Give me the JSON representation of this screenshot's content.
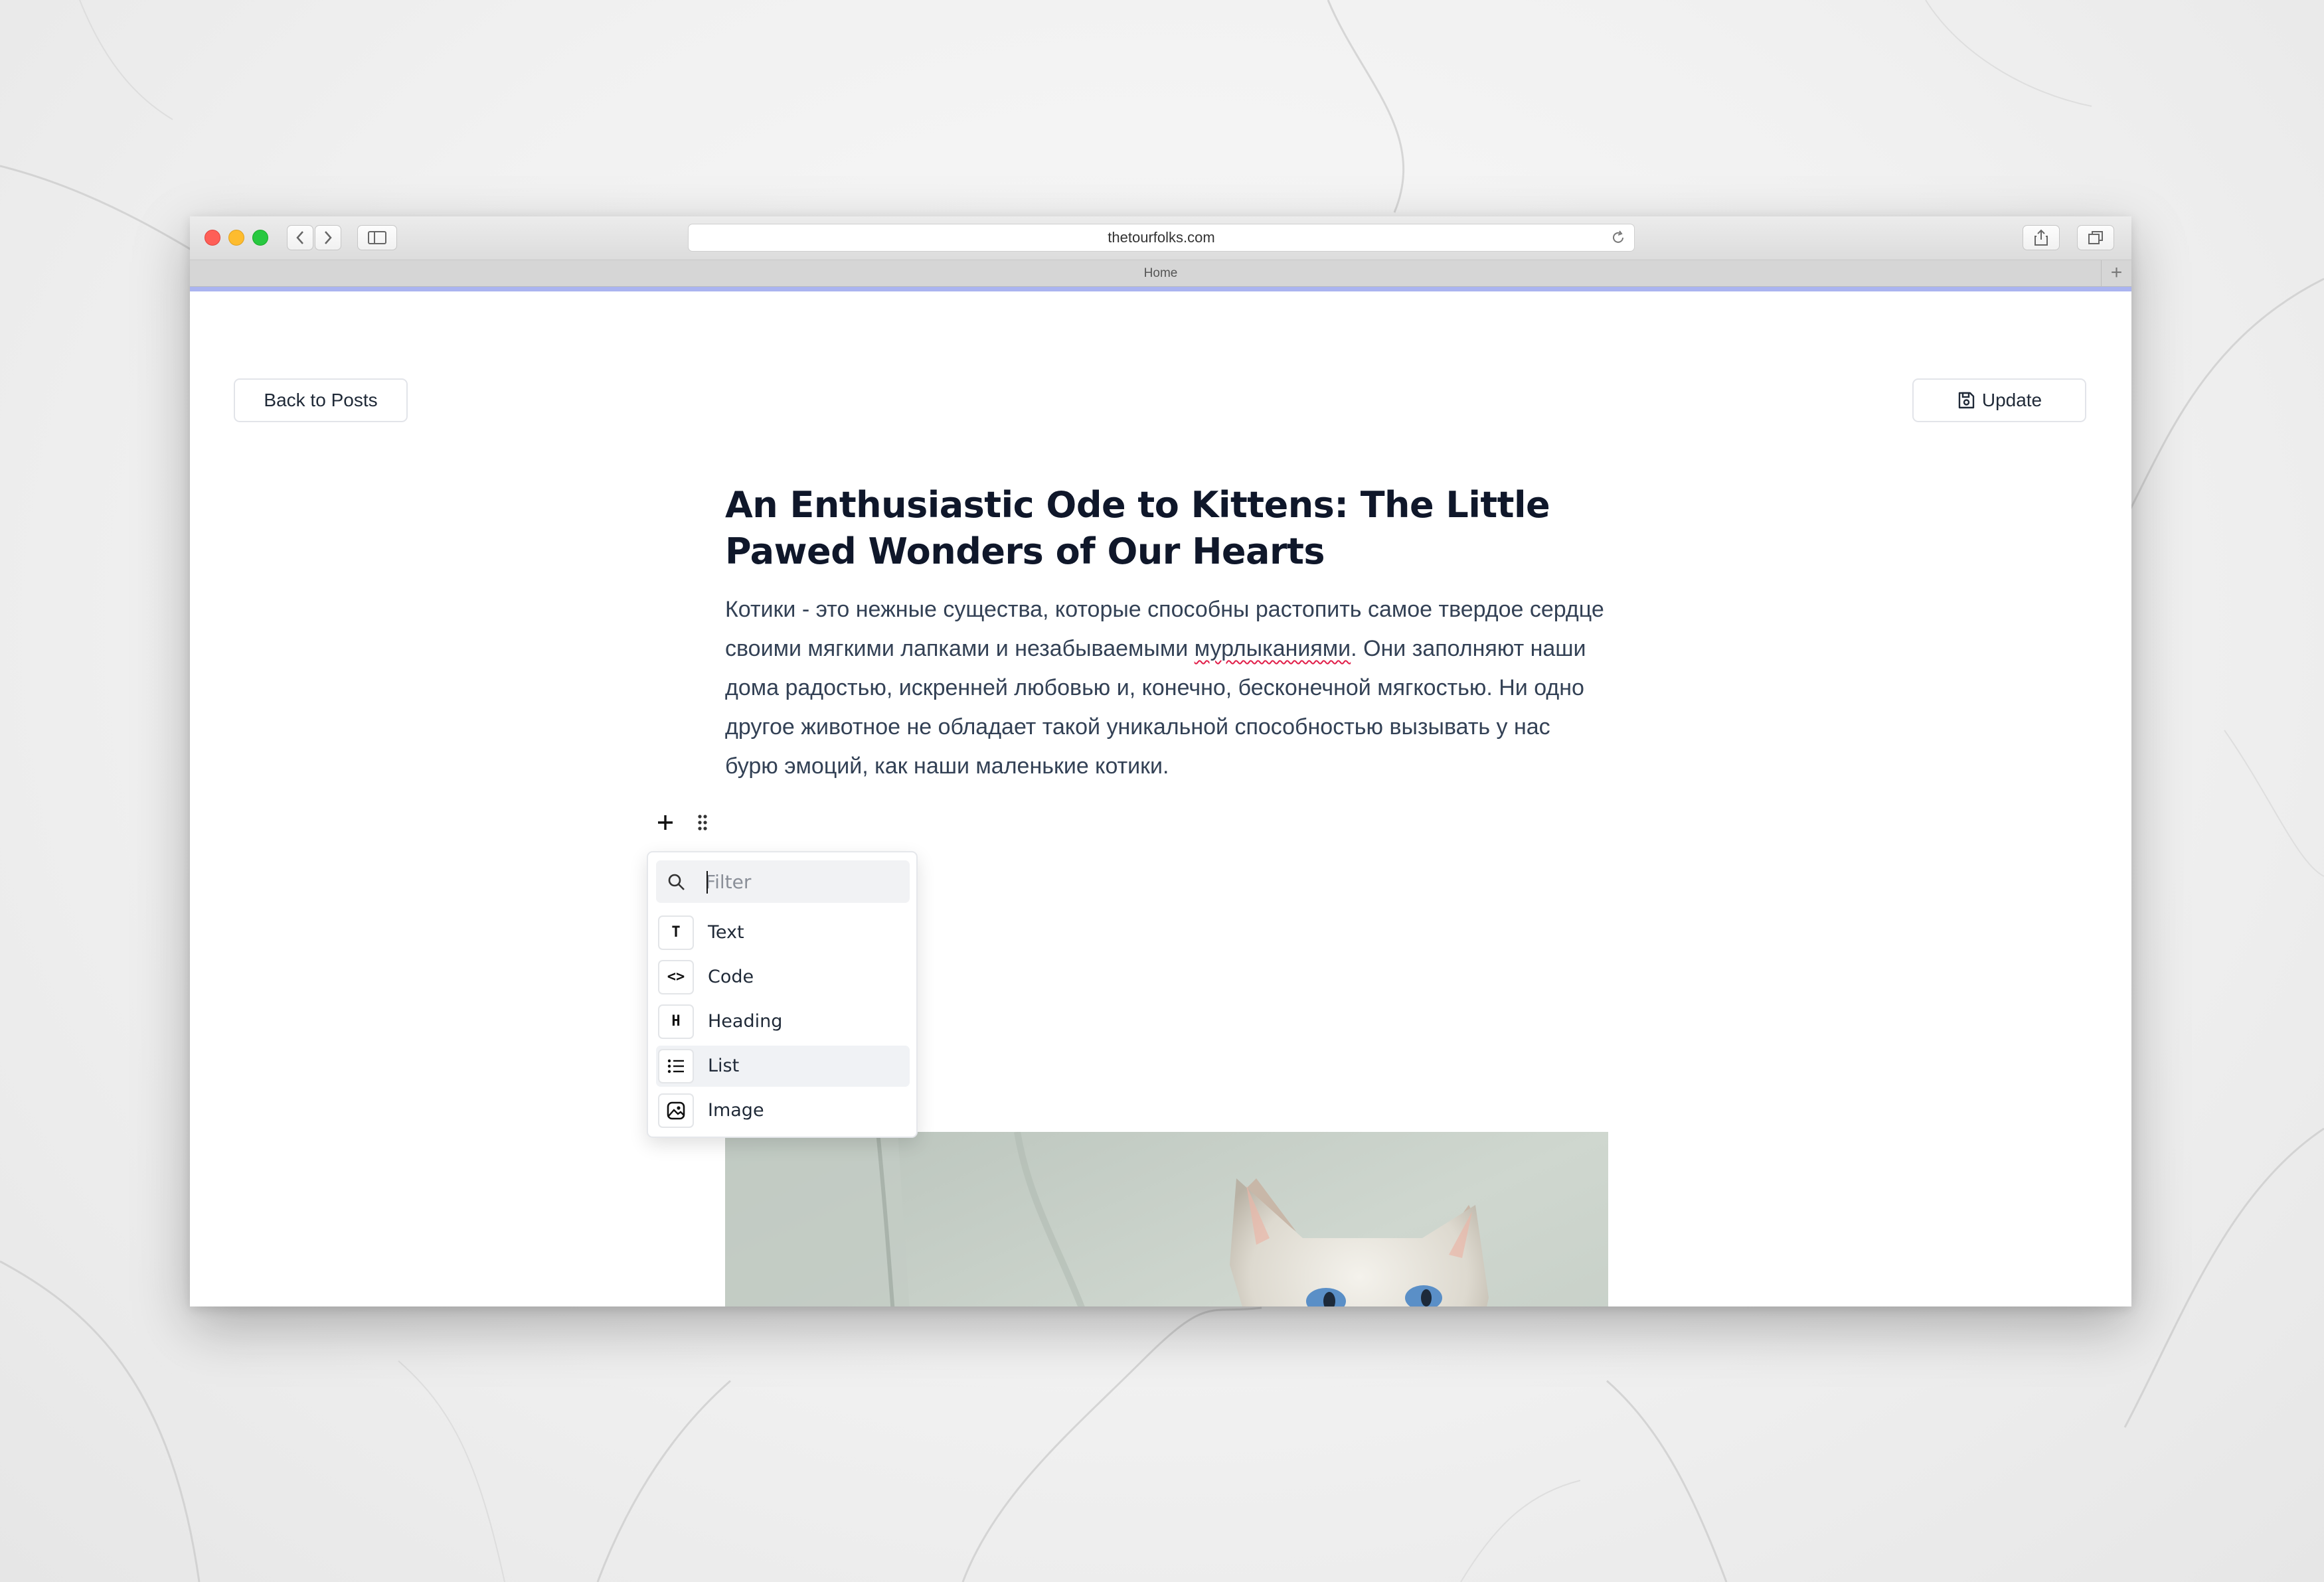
{
  "browser": {
    "url": "thetourfolks.com",
    "tab_title": "Home",
    "new_tab_label": "+"
  },
  "page": {
    "back_button": "Back to Posts",
    "update_button": "Update",
    "title": "An Enthusiastic Ode to Kittens: The Little Pawed Wonders of Our Hearts",
    "body_before": "Котики - это нежные существа, которые способны растопить самое твердое сердце своими мягкими лапками и незабываемыми ",
    "body_misspelled": "мурлыканиями",
    "body_after": ". Они заполняют наши дома радостью, искренней любовью и, конечно, бесконечной мягкостью. Ни одно другое животное не обладает такой уникальной способностью вызывать у нас бурю эмоций, как наши маленькие котики."
  },
  "block_menu": {
    "filter_placeholder": "Filter",
    "items": [
      {
        "label": "Text",
        "icon": "text-type-icon",
        "glyph": "T"
      },
      {
        "label": "Code",
        "icon": "code-icon",
        "glyph": "<>"
      },
      {
        "label": "Heading",
        "icon": "heading-icon",
        "glyph": "H"
      },
      {
        "label": "List",
        "icon": "list-icon",
        "glyph": ""
      },
      {
        "label": "Image",
        "icon": "image-icon",
        "glyph": ""
      }
    ],
    "highlighted_item": "List"
  }
}
